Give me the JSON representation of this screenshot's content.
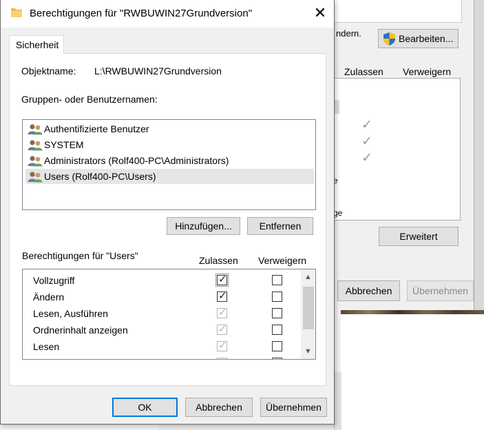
{
  "dialog": {
    "title": "Berechtigungen für \"RWBUWIN27Grundversion\"",
    "close_glyph": "✕",
    "tab_label": "Sicherheit",
    "object_name_label": "Objektname:",
    "object_name_value": "L:\\RWBUWIN27Grundversion",
    "groups_label": "Gruppen- oder Benutzernamen:",
    "groups": [
      {
        "label": "Authentifizierte Benutzer",
        "icon": "users-icon",
        "selected": false
      },
      {
        "label": "SYSTEM",
        "icon": "users-icon",
        "selected": false
      },
      {
        "label": "Administrators (Rolf400-PC\\Administrators)",
        "icon": "users-icon",
        "selected": false
      },
      {
        "label": "Users (Rolf400-PC\\Users)",
        "icon": "users-icon",
        "selected": true
      }
    ],
    "add_button": "Hinzufügen...",
    "remove_button": "Entfernen",
    "permissions_title": "Berechtigungen für \"Users\"",
    "col_allow": "Zulassen",
    "col_deny": "Verweigern",
    "permissions": [
      {
        "label": "Vollzugriff",
        "allow": true,
        "allow_disabled": false,
        "deny": false
      },
      {
        "label": "Ändern",
        "allow": true,
        "allow_disabled": false,
        "deny": false
      },
      {
        "label": "Lesen, Ausführen",
        "allow": true,
        "allow_disabled": true,
        "deny": false
      },
      {
        "label": "Ordnerinhalt anzeigen",
        "allow": true,
        "allow_disabled": true,
        "deny": false
      },
      {
        "label": "Lesen",
        "allow": true,
        "allow_disabled": true,
        "deny": false
      }
    ],
    "ok_button": "OK",
    "cancel_button": "Abbrechen",
    "apply_button": "Übernehmen"
  },
  "background_window": {
    "partial_text_aendern": "ndern.",
    "edit_button": "Bearbeiten...",
    "col_allow": "Zulassen",
    "col_deny": "Verweigern",
    "partial_text_e": "e",
    "partial_text_ge": "ge",
    "advanced_button": "Erweitert",
    "cancel_button": "Abbrechen",
    "apply_button": "Übernehmen"
  },
  "colors": {
    "accent": "#0078d7",
    "dialog_bg": "#f0f0f0",
    "selected_row": "#e5e5e5"
  }
}
